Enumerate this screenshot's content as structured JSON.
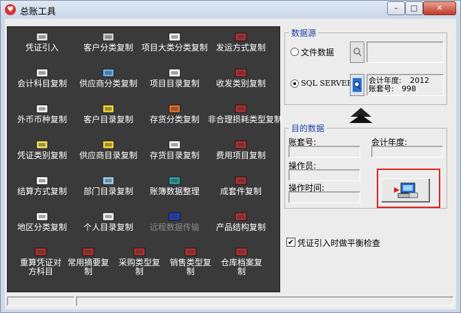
{
  "window": {
    "title": "总账工具",
    "minimize_glyph": "–",
    "maximize_glyph": "□",
    "close_glyph": "✕"
  },
  "tools": [
    {
      "label": "凭证引入",
      "icon": "voucher-import-icon",
      "color": "#e8e8e8",
      "enabled": true
    },
    {
      "label": "客户分类复制",
      "icon": "customer-category-icon",
      "color": "#d0d0d0",
      "enabled": true
    },
    {
      "label": "项目大类分类复制",
      "icon": "project-class-icon",
      "color": "#ffffff",
      "enabled": true
    },
    {
      "label": "发运方式复制",
      "icon": "shipping-method-icon",
      "color": "#b03030",
      "enabled": true
    },
    {
      "label": "会计科目复制",
      "icon": "account-subject-icon",
      "color": "#f5f5f5",
      "enabled": true
    },
    {
      "label": "供应商分类复制",
      "icon": "supplier-category-icon",
      "color": "#6ab0e8",
      "enabled": true
    },
    {
      "label": "项目目录复制",
      "icon": "project-catalog-icon",
      "color": "#ffffff",
      "enabled": true
    },
    {
      "label": "收发类别复制",
      "icon": "receive-send-icon",
      "color": "#b03030",
      "enabled": true
    },
    {
      "label": "外币币种复制",
      "icon": "currency-icon",
      "color": "#ffffff",
      "enabled": true
    },
    {
      "label": "客户目录复制",
      "icon": "customer-catalog-icon",
      "color": "#f2d23a",
      "enabled": true
    },
    {
      "label": "存货分类复制",
      "icon": "inventory-category-icon",
      "color": "#e07030",
      "enabled": true
    },
    {
      "label": "非合理损耗类型复制",
      "icon": "loss-type-icon",
      "color": "#b03030",
      "enabled": true
    },
    {
      "label": "凭证类别复制",
      "icon": "voucher-type-icon",
      "color": "#f2e060",
      "enabled": true
    },
    {
      "label": "供应商目录复制",
      "icon": "supplier-catalog-icon",
      "color": "#f2d23a",
      "enabled": true
    },
    {
      "label": "存货目录复制",
      "icon": "inventory-catalog-icon",
      "color": "#ffffff",
      "enabled": true
    },
    {
      "label": "费用项目复制",
      "icon": "expense-item-icon",
      "color": "#b03030",
      "enabled": true
    },
    {
      "label": "结算方式复制",
      "icon": "settlement-method-icon",
      "color": "#ffffff",
      "enabled": true
    },
    {
      "label": "部门目录复制",
      "icon": "department-catalog-icon",
      "color": "#9ad0f0",
      "enabled": true
    },
    {
      "label": "账簿数据整理",
      "icon": "ledger-data-icon",
      "color": "#2fa0a0",
      "enabled": true
    },
    {
      "label": "成套件复制",
      "icon": "kit-icon",
      "color": "#b03030",
      "enabled": true
    },
    {
      "label": "地区分类复制",
      "icon": "region-category-icon",
      "color": "#ffffff",
      "enabled": true
    },
    {
      "label": "个人目录复制",
      "icon": "personal-catalog-icon",
      "color": "#ffffff",
      "enabled": true
    },
    {
      "label": "远程数据传输",
      "icon": "remote-transfer-icon",
      "color": "#2040c0",
      "enabled": false
    },
    {
      "label": "产品结构复制",
      "icon": "product-structure-icon",
      "color": "#b03030",
      "enabled": true
    },
    {
      "label": "重算凭证对方科目",
      "icon": "recalc-voucher-icon",
      "color": "#b03030",
      "enabled": true
    },
    {
      "label": "常用摘要复制",
      "icon": "common-summary-icon",
      "color": "#b03030",
      "enabled": true
    },
    {
      "label": "采购类型复制",
      "icon": "purchase-type-icon",
      "color": "#b03030",
      "enabled": true
    },
    {
      "label": "销售类型复制",
      "icon": "sales-type-icon",
      "color": "#b03030",
      "enabled": true
    },
    {
      "label": "仓库档案复制",
      "icon": "warehouse-archive-icon",
      "color": "#b03030",
      "enabled": true
    }
  ],
  "source": {
    "legend": "数据源",
    "file_option": "文件数据",
    "sql_option": "SQL SERVER",
    "selected": "sql",
    "year_label": "会计年度:",
    "year_value": "2012",
    "account_label": "账套号:",
    "account_value": "998"
  },
  "target": {
    "legend": "目的数据",
    "account_label": "账套号:",
    "year_label": "会计年度:",
    "operator_label": "操作员:",
    "time_label": "操作时间:"
  },
  "balance_check": {
    "label": "凭证引入时做平衡检查",
    "checked": true,
    "mark": "✔"
  },
  "colors": {
    "icon_panel": "#3a3a3a",
    "legend_text": "#1a3fa8",
    "highlight": "#e0201b"
  }
}
